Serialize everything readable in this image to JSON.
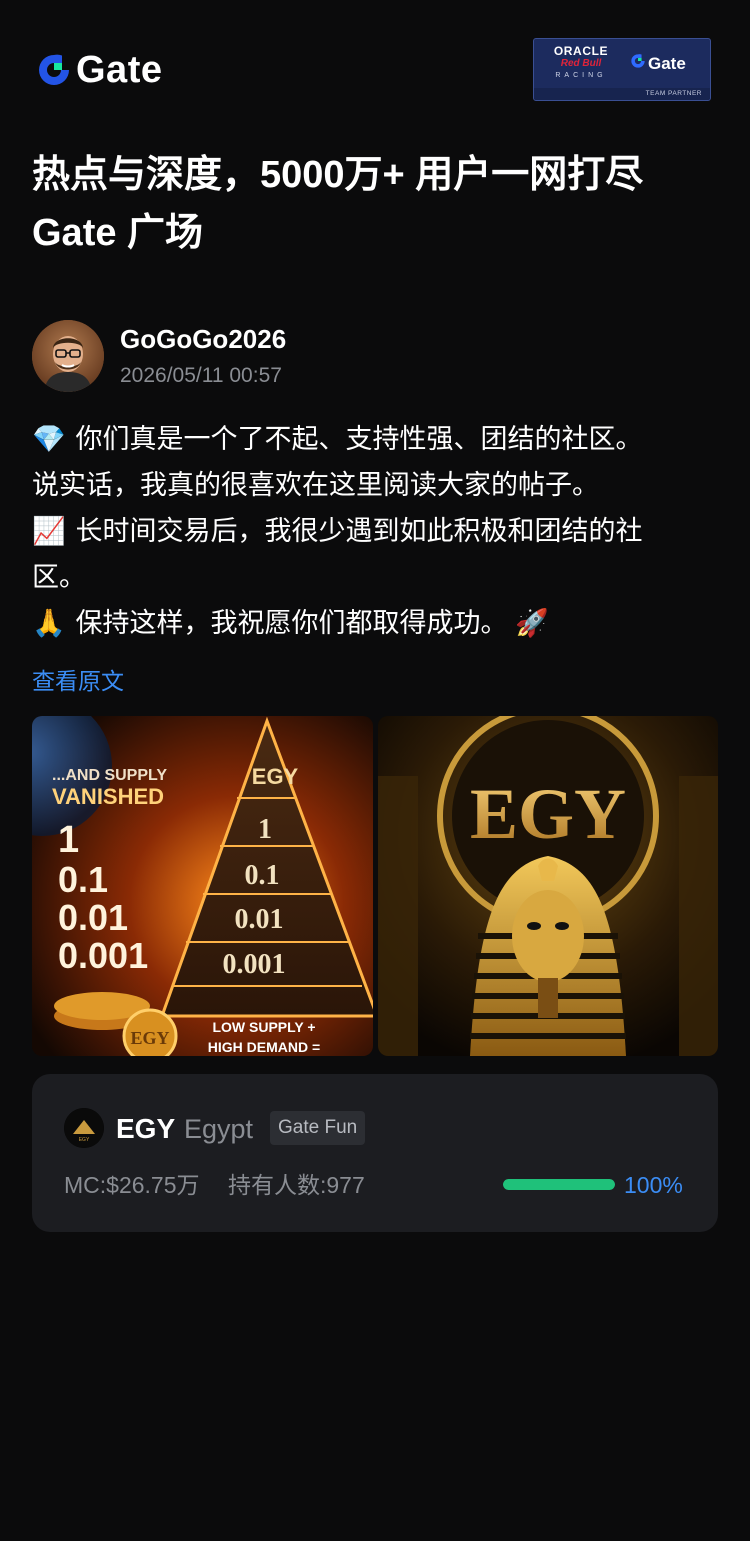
{
  "header": {
    "logo_text": "Gate",
    "logo_icon": "gate-logo-icon",
    "partner": {
      "oracle": "ORACLE",
      "redbull": "Red Bull",
      "racing": "RACING",
      "gate": "Gate",
      "tagline": "TEAM PARTNER"
    }
  },
  "title": {
    "line1": "热点与深度，5000万+ 用户一网打尽",
    "line2": "Gate 广场"
  },
  "author": {
    "name": "GoGoGo2026",
    "time": "2026/05/11 00:57"
  },
  "post": {
    "lines": [
      {
        "emoji": "💎",
        "text": " 你们真是一个了不起、支持性强、团结的社区。"
      },
      {
        "emoji": "",
        "text": "说实话，我真的很喜欢在这里阅读大家的帖子。"
      },
      {
        "emoji": "📈",
        "text": " 长时间交易后，我很少遇到如此积极和团结的社"
      },
      {
        "emoji": "",
        "text": "区。"
      },
      {
        "emoji": "🙏",
        "text": " 保持这样，我祝愿你们都取得成功。 🚀"
      }
    ],
    "view_original": "查看原文"
  },
  "images": {
    "left": {
      "header_text": "...AND SUPPLY",
      "header_text2": "VANISHED",
      "values": [
        "1",
        "0.1",
        "0.01",
        "0.001"
      ],
      "pyramid_label": "EGY",
      "pyramid_values": [
        "1",
        "0.1",
        "0.01",
        "0.001"
      ],
      "coin_label": "EGY",
      "footer1": "LOW SUPPLY +",
      "footer2": "HIGH DEMAND ="
    },
    "right": {
      "title": "EGY"
    }
  },
  "token": {
    "symbol": "EGY",
    "name": "Egypt",
    "tag": "Gate Fun",
    "mc": "MC:$26.75万",
    "holders": "持有人数:977",
    "progress": 1.0,
    "progress_label": "100%",
    "progress_color": "#1fc17a"
  }
}
